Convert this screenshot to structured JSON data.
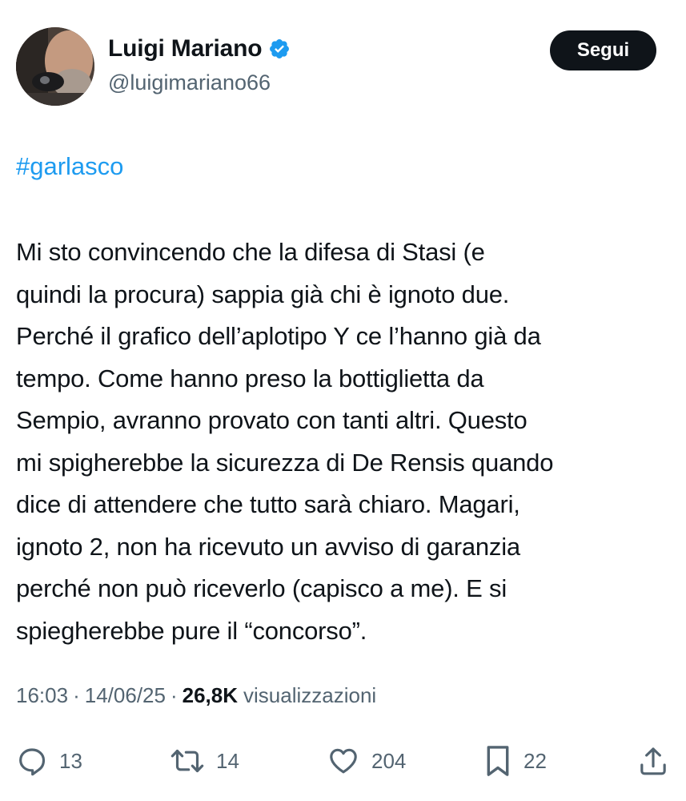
{
  "author": {
    "display_name": "Luigi Mariano",
    "handle": "@luigimariano66",
    "verified": true,
    "verified_color": "#1d9bf0"
  },
  "follow_button": {
    "label": "Segui"
  },
  "tweet": {
    "hashtag": "#garlasco",
    "text": "Mi sto convincendo che la difesa di Stasi (e\nquindi la procura) sappia già chi è ignoto due.\nPerché il grafico dell’aplotipo Y ce l’hanno già da\ntempo. Come hanno preso la bottiglietta da\nSempio, avranno provato con tanti altri. Questo\nmi spigherebbe la sicurezza di De Rensis quando\ndice di attendere che tutto sarà chiaro. Magari,\nignoto 2, non ha ricevuto un avviso di garanzia\nperché non può riceverlo (capisco a me). E si\nspiegherebbe pure il “concorso”."
  },
  "meta": {
    "time": "16:03",
    "separator": "·",
    "date": "14/06/25",
    "views_count": "26,8K",
    "views_label": "visualizzazioni"
  },
  "actions": {
    "replies": {
      "icon": "reply-icon",
      "count": "13"
    },
    "reposts": {
      "icon": "repost-icon",
      "count": "14"
    },
    "likes": {
      "icon": "heart-icon",
      "count": "204"
    },
    "bookmarks": {
      "icon": "bookmark-icon",
      "count": "22"
    },
    "share": {
      "icon": "share-icon"
    }
  },
  "colors": {
    "text": "#0f1419",
    "secondary": "#536471",
    "accent": "#1d9bf0",
    "button_bg": "#0f1419"
  }
}
